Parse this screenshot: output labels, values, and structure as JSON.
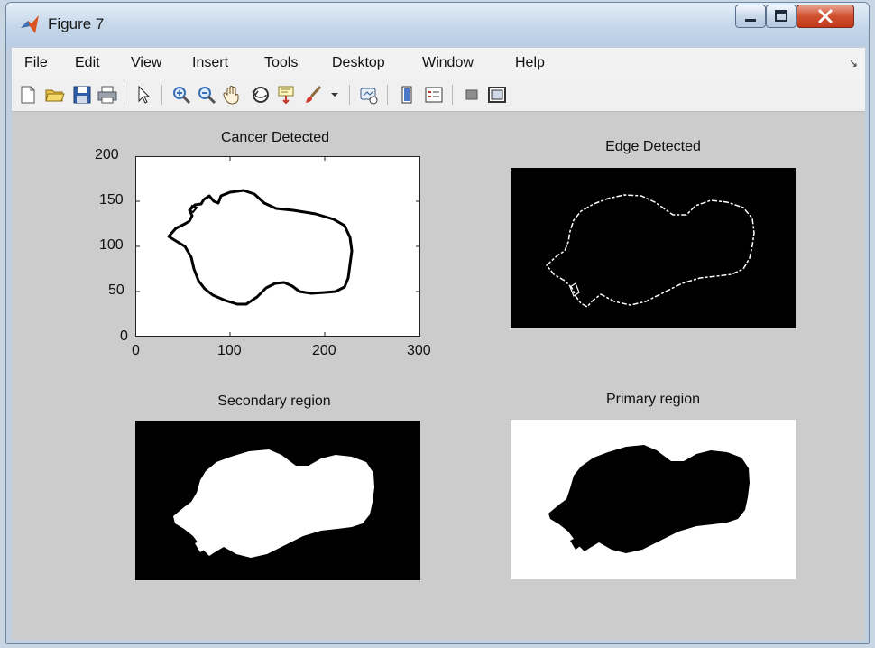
{
  "window": {
    "title": "Figure 7",
    "controls": [
      "minimize",
      "maximize",
      "close"
    ]
  },
  "menubar": {
    "items": [
      {
        "label": "File"
      },
      {
        "label": "Edit"
      },
      {
        "label": "View"
      },
      {
        "label": "Insert"
      },
      {
        "label": "Tools"
      },
      {
        "label": "Desktop"
      },
      {
        "label": "Window"
      },
      {
        "label": "Help"
      }
    ]
  },
  "toolbar": {
    "icons": [
      "new-figure-icon",
      "open-file-icon",
      "save-icon",
      "print-icon",
      "pointer-icon",
      "zoom-in-icon",
      "zoom-out-icon",
      "pan-hand-icon",
      "rotate-3d-icon",
      "data-cursor-icon",
      "brush-icon",
      "link-plot-icon",
      "colorbar-icon",
      "legend-icon",
      "hide-plot-tools-icon",
      "show-plot-tools-icon"
    ]
  },
  "subplots": [
    {
      "title": "Cancer Detected",
      "type": "plot",
      "xlim": [
        0,
        300
      ],
      "ylim": [
        0,
        200
      ],
      "xticks": [
        "0",
        "100",
        "200",
        "300"
      ],
      "yticks": [
        "0",
        "50",
        "100",
        "150",
        "200"
      ]
    },
    {
      "title": "Edge Detected",
      "type": "image",
      "background": "#000000"
    },
    {
      "title": "Secondary region",
      "type": "image",
      "background": "#000000"
    },
    {
      "title": "Primary region",
      "type": "image",
      "background": "#ffffff"
    }
  ],
  "colors": {
    "plot_area": "#cccccc",
    "titlebar_close": "#c94a2b"
  }
}
